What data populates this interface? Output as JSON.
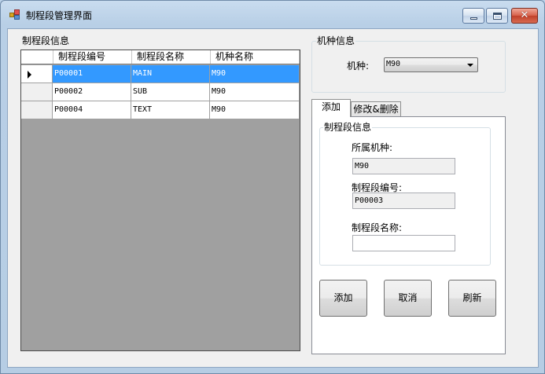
{
  "window": {
    "title": "制程段管理界面"
  },
  "left_group": {
    "title": "制程段信息",
    "columns": [
      "制程段编号",
      "制程段名称",
      "机种名称"
    ],
    "rows": [
      {
        "cells": [
          "P00001",
          "MAIN",
          "M90"
        ],
        "selected": true
      },
      {
        "cells": [
          "P00002",
          "SUB",
          "M90"
        ],
        "selected": false
      },
      {
        "cells": [
          "P00004",
          "TEXT",
          "M90"
        ],
        "selected": false
      }
    ]
  },
  "model_group": {
    "title": "机种信息",
    "label": "机种:",
    "selected": "M90"
  },
  "tabs": [
    {
      "label": "添加",
      "active": true
    },
    {
      "label": "修改&删除",
      "active": false
    }
  ],
  "add_tab": {
    "group_title": "制程段信息",
    "model_label": "所属机种:",
    "model_value": "M90",
    "code_label": "制程段编号:",
    "code_value": "P00003",
    "name_label": "制程段名称:",
    "name_value": ""
  },
  "buttons": {
    "add": "添加",
    "cancel": "取消",
    "refresh": "刷新"
  }
}
